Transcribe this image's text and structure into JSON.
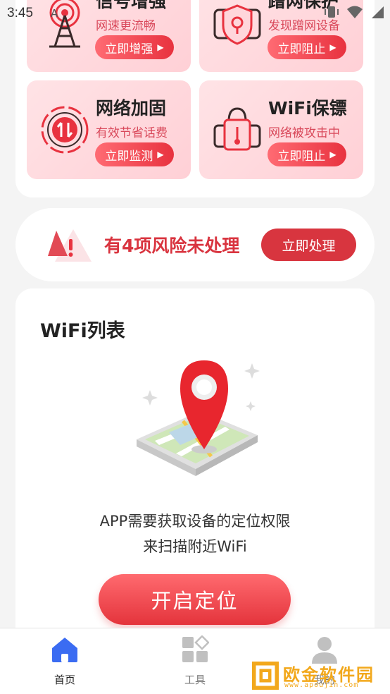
{
  "status_bar": {
    "time": "3:45"
  },
  "features": [
    {
      "title": "信号增强",
      "subtitle": "网速更流畅",
      "button": "立即增强",
      "icon": "signal-tower-icon"
    },
    {
      "title": "蹭网保护",
      "subtitle": "发现蹭网设备",
      "button": "立即阻止",
      "icon": "shield-lock-icon"
    },
    {
      "title": "网络加固",
      "subtitle": "有效节省话费",
      "button": "立即监测",
      "icon": "network-reinforce-icon"
    },
    {
      "title": "WiFi保镖",
      "subtitle": "网络被攻击中",
      "button": "立即阻止",
      "icon": "padlock-thermometer-icon"
    }
  ],
  "risk": {
    "text": "有4项风险未处理",
    "button": "立即处理",
    "icon": "warning-icon"
  },
  "wifi_list": {
    "title": "WiFi列表",
    "permission_line1": "APP需要获取设备的定位权限",
    "permission_line2": "来扫描附近WiFi",
    "button": "开启定位",
    "illustration": "map-pin-icon"
  },
  "nav": {
    "items": [
      {
        "label": "首页",
        "icon": "home-icon",
        "active": true
      },
      {
        "label": "工具",
        "icon": "tools-grid-icon",
        "active": false
      },
      {
        "label": "我的",
        "icon": "profile-icon",
        "active": false
      }
    ]
  },
  "watermark": {
    "text": "欧金软件园",
    "sub": "www.apoujin.com"
  },
  "colors": {
    "accent": "#e8323f",
    "tile_bg": "#ffd6db",
    "text_red": "#d9485a"
  }
}
